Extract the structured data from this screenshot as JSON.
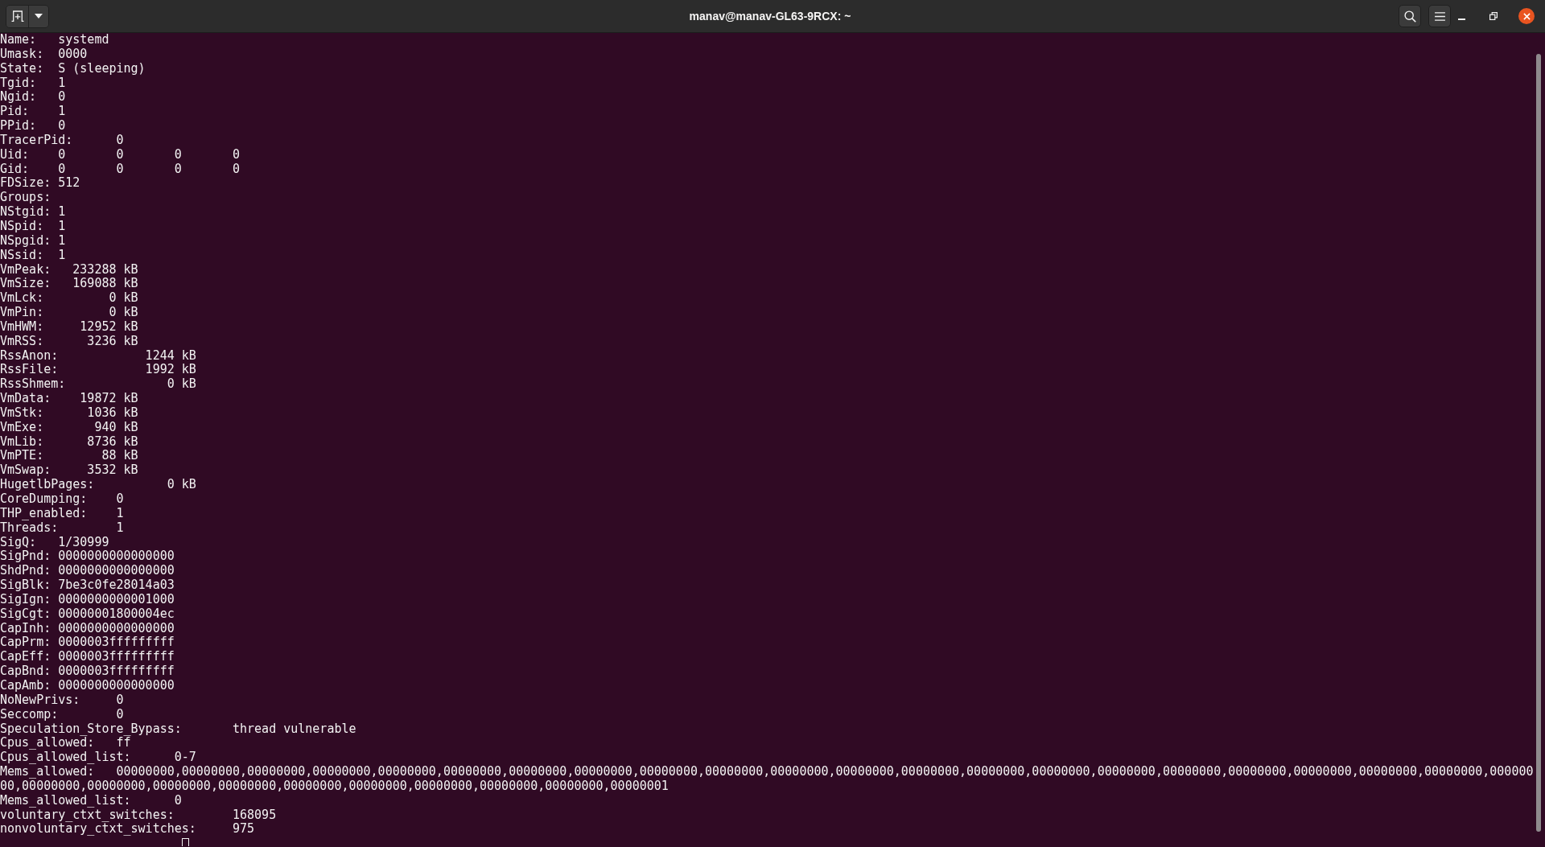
{
  "window": {
    "title": "manav@manav-GL63-9RCX: ~"
  },
  "terminal": {
    "lines": [
      "Name:   systemd",
      "Umask:  0000",
      "State:  S (sleeping)",
      "Tgid:   1",
      "Ngid:   0",
      "Pid:    1",
      "PPid:   0",
      "TracerPid:      0",
      "Uid:    0       0       0       0",
      "Gid:    0       0       0       0",
      "FDSize: 512",
      "Groups:",
      "NStgid: 1",
      "NSpid:  1",
      "NSpgid: 1",
      "NSsid:  1",
      "VmPeak:   233288 kB",
      "VmSize:   169088 kB",
      "VmLck:         0 kB",
      "VmPin:         0 kB",
      "VmHWM:     12952 kB",
      "VmRSS:      3236 kB",
      "RssAnon:            1244 kB",
      "RssFile:            1992 kB",
      "RssShmem:              0 kB",
      "VmData:    19872 kB",
      "VmStk:      1036 kB",
      "VmExe:       940 kB",
      "VmLib:      8736 kB",
      "VmPTE:        88 kB",
      "VmSwap:     3532 kB",
      "HugetlbPages:          0 kB",
      "CoreDumping:    0",
      "THP_enabled:    1",
      "Threads:        1",
      "SigQ:   1/30999",
      "SigPnd: 0000000000000000",
      "ShdPnd: 0000000000000000",
      "SigBlk: 7be3c0fe28014a03",
      "SigIgn: 0000000000001000",
      "SigCgt: 00000001800004ec",
      "CapInh: 0000000000000000",
      "CapPrm: 0000003fffffffff",
      "CapEff: 0000003fffffffff",
      "CapBnd: 0000003fffffffff",
      "CapAmb: 0000000000000000",
      "NoNewPrivs:     0",
      "Seccomp:        0",
      "Speculation_Store_Bypass:       thread vulnerable",
      "Cpus_allowed:   ff",
      "Cpus_allowed_list:      0-7",
      "Mems_allowed:   00000000,00000000,00000000,00000000,00000000,00000000,00000000,00000000,00000000,00000000,00000000,00000000,00000000,00000000,00000000,00000000,00000000,00000000,00000000,00000000,00000000,000000",
      "00,00000000,00000000,00000000,00000000,00000000,00000000,00000000,00000000,00000000,00000001",
      "Mems_allowed_list:      0",
      "voluntary_ctxt_switches:        168095",
      "nonvoluntary_ctxt_switches:     975"
    ],
    "cursor": {
      "focused": false
    }
  }
}
